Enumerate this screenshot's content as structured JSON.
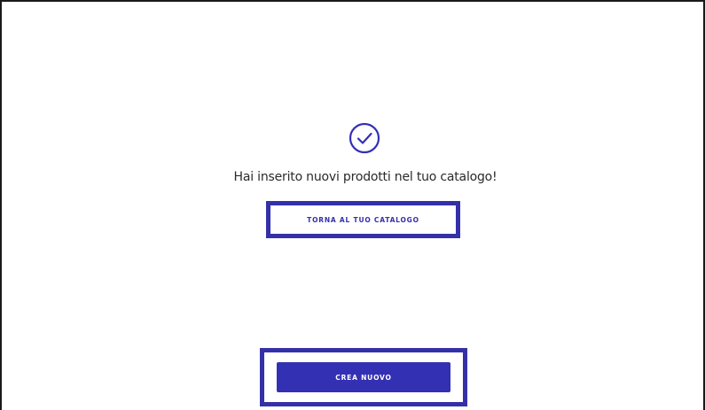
{
  "success": {
    "icon": "check-circle-icon",
    "message": "Hai inserito nuovi prodotti nel tuo catalogo!"
  },
  "actions": {
    "back_label": "TORNA AL TUO CATALOGO",
    "create_label": "CREA NUOVO"
  },
  "colors": {
    "accent": "#3430b4",
    "highlight_border": "#3430a8",
    "text": "#2a2a2a",
    "frame_border": "#1a1a1a"
  }
}
